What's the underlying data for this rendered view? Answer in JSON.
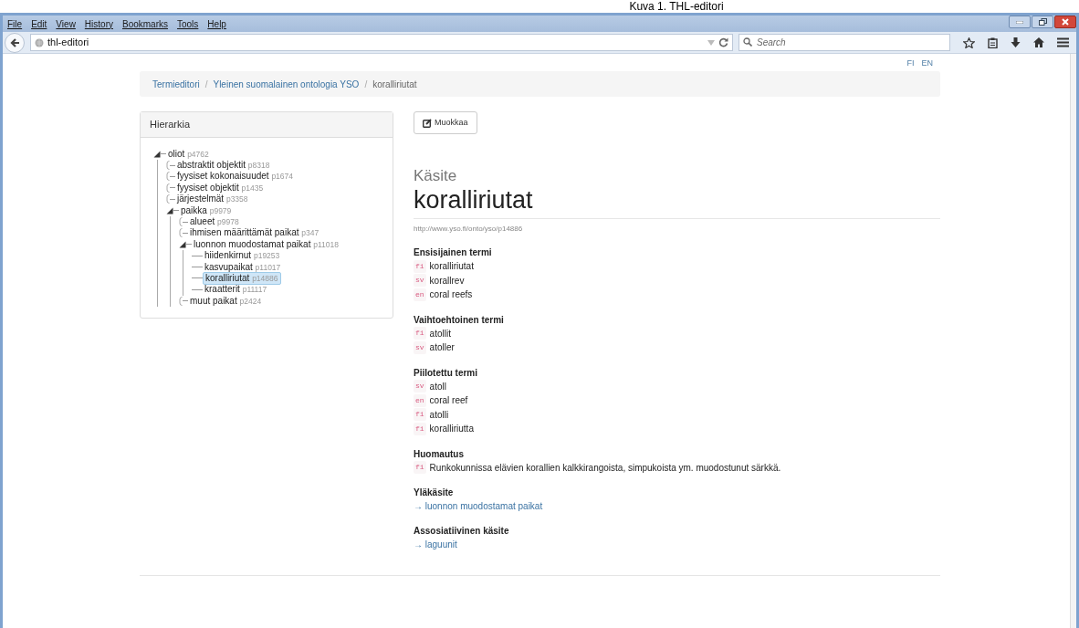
{
  "caption": "Kuva 1. THL-editori",
  "menu": [
    "File",
    "Edit",
    "View",
    "History",
    "Bookmarks",
    "Tools",
    "Help"
  ],
  "address": "thl-editori",
  "search": {
    "placeholder": "Search"
  },
  "languages": [
    "FI",
    "EN"
  ],
  "breadcrumb_separator": "/",
  "breadcrumb": [
    "Termieditori",
    "Yleinen suomalainen ontologia YSO",
    "koralliriutat"
  ],
  "hierarchy": {
    "title": "Hierarkia",
    "tree": [
      {
        "label": "oliot",
        "id": "p4762",
        "selected": false,
        "expanded": true,
        "children": [
          {
            "label": "abstraktit objektit",
            "id": "p8318",
            "selected": false,
            "expanded": false
          },
          {
            "label": "fyysiset kokonaisuudet",
            "id": "p1674",
            "selected": false,
            "expanded": false
          },
          {
            "label": "fyysiset objektit",
            "id": "p1435",
            "selected": false,
            "expanded": false
          },
          {
            "label": "järjestelmät",
            "id": "p3358",
            "selected": false,
            "expanded": false
          },
          {
            "label": "paikka",
            "id": "p9979",
            "selected": false,
            "expanded": true,
            "children": [
              {
                "label": "alueet",
                "id": "p9978",
                "selected": false,
                "expanded": false
              },
              {
                "label": "ihmisen määrittämät paikat",
                "id": "p347",
                "selected": false,
                "expanded": false
              },
              {
                "label": "luonnon muodostamat paikat",
                "id": "p11018",
                "selected": false,
                "expanded": true,
                "children": [
                  {
                    "label": "hiidenkirnut",
                    "id": "p19253",
                    "selected": false
                  },
                  {
                    "label": "kasvupaikat",
                    "id": "p11017",
                    "selected": false
                  },
                  {
                    "label": "koralliriutat",
                    "id": "p14886",
                    "selected": true
                  },
                  {
                    "label": "kraatterit",
                    "id": "p11117",
                    "selected": false
                  }
                ]
              },
              {
                "label": "muut paikat",
                "id": "p2424",
                "selected": false,
                "expanded": false
              }
            ]
          }
        ]
      }
    ]
  },
  "edit_button": "Muokkaa",
  "concept": {
    "type_label": "Käsite",
    "title": "koralliriutat",
    "uri": "http://www.yso.fi/onto/yso/p14886",
    "sections": [
      {
        "heading": "Ensisijainen termi",
        "kind": "terms",
        "items": [
          {
            "lang": "fi",
            "text": "koralliriutat"
          },
          {
            "lang": "sv",
            "text": "korallrev"
          },
          {
            "lang": "en",
            "text": "coral reefs"
          }
        ]
      },
      {
        "heading": "Vaihtoehtoinen termi",
        "kind": "terms",
        "items": [
          {
            "lang": "fi",
            "text": "atollit"
          },
          {
            "lang": "sv",
            "text": "atoller"
          }
        ]
      },
      {
        "heading": "Piilotettu termi",
        "kind": "terms",
        "items": [
          {
            "lang": "sv",
            "text": "atoll"
          },
          {
            "lang": "en",
            "text": "coral reef"
          },
          {
            "lang": "fi",
            "text": "atolli"
          },
          {
            "lang": "fi",
            "text": "koralliriutta"
          }
        ]
      },
      {
        "heading": "Huomautus",
        "kind": "terms",
        "items": [
          {
            "lang": "fi",
            "text": "Runkokunnissa elävien korallien kalkkirangoista, simpukoista ym. muodostunut särkkä."
          }
        ]
      },
      {
        "heading": "Yläkäsite",
        "kind": "links",
        "items": [
          "→ luonnon muodostamat paikat"
        ]
      },
      {
        "heading": "Assosiatiivinen käsite",
        "kind": "links",
        "items": [
          "→ laguunit"
        ]
      }
    ]
  }
}
